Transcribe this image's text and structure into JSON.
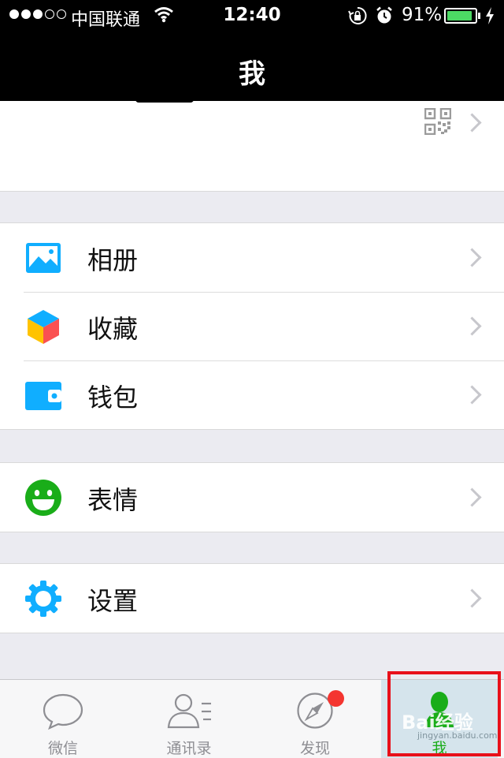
{
  "status_bar": {
    "carrier": "中国联通",
    "time": "12:40",
    "battery_percent": "91%",
    "battery_level": 0.91,
    "signal_bars_filled": 3,
    "signal_bars_total": 5,
    "icons": [
      "wifi-icon",
      "rotation-lock-icon",
      "alarm-icon",
      "battery-icon",
      "charging-bolt-icon"
    ]
  },
  "nav": {
    "title": "我"
  },
  "profile": {
    "icons": [
      "qr-code-icon",
      "chevron-right-icon"
    ]
  },
  "menu": {
    "group1": [
      {
        "label": "相册",
        "icon": "photo-album-icon"
      },
      {
        "label": "收藏",
        "icon": "favorites-cube-icon"
      },
      {
        "label": "钱包",
        "icon": "wallet-icon"
      }
    ],
    "group2": [
      {
        "label": "表情",
        "icon": "smiley-icon"
      }
    ],
    "group3": [
      {
        "label": "设置",
        "icon": "settings-gear-icon"
      }
    ]
  },
  "tabbar": {
    "tabs": [
      {
        "label": "微信",
        "icon": "chat-bubble-icon"
      },
      {
        "label": "通讯录",
        "icon": "contacts-icon"
      },
      {
        "label": "发现",
        "icon": "compass-icon",
        "badge": true
      },
      {
        "label": "我",
        "icon": "me-person-icon",
        "active": true
      }
    ]
  },
  "watermark": {
    "text": "Bai经验",
    "sub": "jingyan.baidu.com"
  },
  "colors": {
    "accent_green": "#1aad19",
    "icon_blue": "#10aeff",
    "badge_red": "#f43530",
    "highlight_red": "#e8101a",
    "background": "#ebebf1"
  }
}
